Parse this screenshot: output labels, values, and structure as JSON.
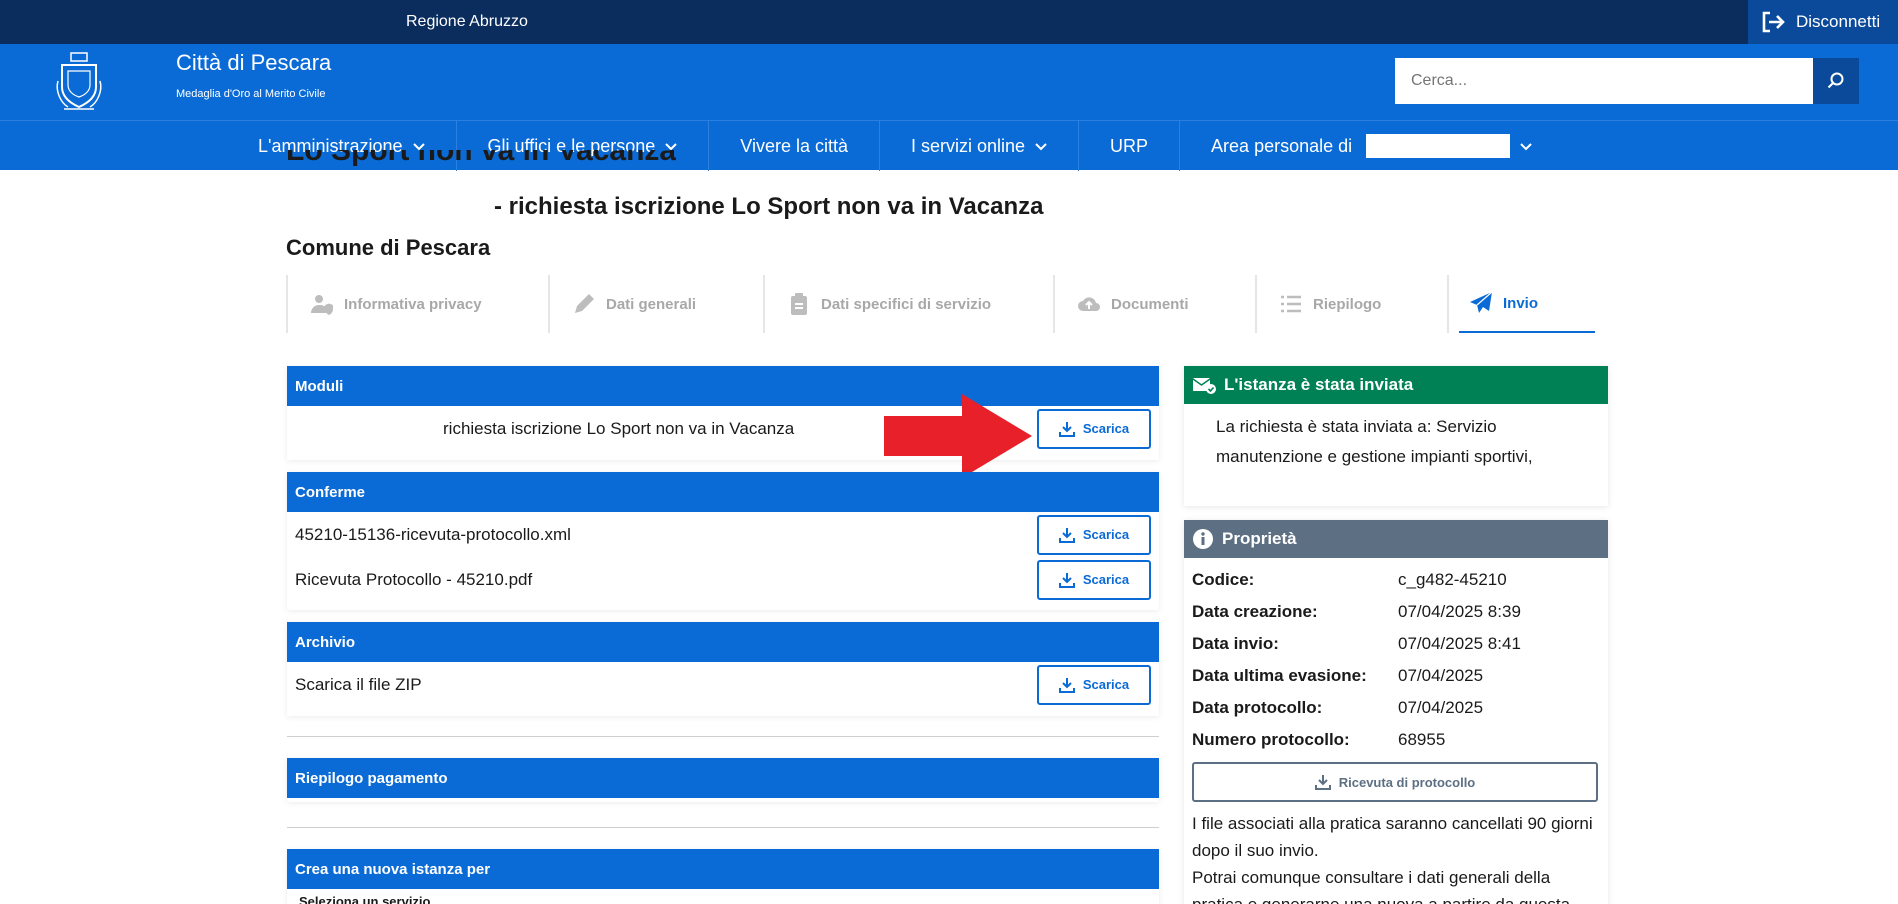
{
  "topbar": {
    "region": "Regione Abruzzo",
    "logout": "Disconnetti"
  },
  "header": {
    "title": "Città di Pescara",
    "subtitle": "Medaglia d'Oro al Merito Civile",
    "search_placeholder": "Cerca..."
  },
  "nav": {
    "items": [
      {
        "label": "L'amministrazione",
        "dropdown": true
      },
      {
        "label": "Gli uffici e le persone",
        "dropdown": true
      },
      {
        "label": "Vivere la città",
        "dropdown": false
      },
      {
        "label": "I servizi online",
        "dropdown": true
      },
      {
        "label": "URP",
        "dropdown": false
      },
      {
        "label": "Area personale di",
        "dropdown": true
      }
    ]
  },
  "page": {
    "partial_title": "Lo Sport non va in Vacanza",
    "title": "- richiesta iscrizione Lo Sport non va in Vacanza",
    "organization": "Comune di Pescara"
  },
  "steps": [
    {
      "label": "Informativa privacy",
      "icon": "user-shield-icon"
    },
    {
      "label": "Dati generali",
      "icon": "pencil-icon"
    },
    {
      "label": "Dati specifici di servizio",
      "icon": "clipboard-icon"
    },
    {
      "label": "Documenti",
      "icon": "cloud-upload-icon"
    },
    {
      "label": "Riepilogo",
      "icon": "list-icon"
    },
    {
      "label": "Invio",
      "icon": "paper-plane-icon"
    }
  ],
  "moduli": {
    "header": "Moduli",
    "rows": [
      {
        "label": "richiesta iscrizione Lo Sport non va in Vacanza",
        "button": "Scarica"
      }
    ]
  },
  "conferme": {
    "header": "Conferme",
    "rows": [
      {
        "label": "45210-15136-ricevuta-protocollo.xml",
        "button": "Scarica"
      },
      {
        "label": "Ricevuta Protocollo - 45210.pdf",
        "button": "Scarica"
      }
    ]
  },
  "archivio": {
    "header": "Archivio",
    "rows": [
      {
        "label": "Scarica il file ZIP",
        "button": "Scarica"
      }
    ]
  },
  "pagamento": {
    "header": "Riepilogo pagamento"
  },
  "nuova": {
    "header": "Crea una nuova istanza per",
    "select_label": "Seleziona un servizio"
  },
  "inviata": {
    "header": "L'istanza è stata inviata",
    "text": "La richiesta è stata inviata a: Servizio manutenzione e gestione impianti sportivi,"
  },
  "proprieta": {
    "header": "Proprietà",
    "items": [
      {
        "key": "Codice:",
        "value": "c_g482-45210"
      },
      {
        "key": "Data creazione:",
        "value": "07/04/2025 8:39"
      },
      {
        "key": "Data invio:",
        "value": "07/04/2025 8:41"
      },
      {
        "key": "Data ultima evasione:",
        "value": "07/04/2025"
      },
      {
        "key": "Data protocollo:",
        "value": "07/04/2025"
      },
      {
        "key": "Numero protocollo:",
        "value": "68955"
      }
    ],
    "button": "Ricevuta di protocollo",
    "note1": "I file associati alla pratica saranno cancellati 90 giorni dopo il suo invio.",
    "note2": "Potrai comunque consultare i dati generali della pratica e generarne una nuova a partire da questa."
  },
  "colors": {
    "primary": "#0b6bd6",
    "dark_navy": "#0a2d5e",
    "success": "#008055",
    "gray_header": "#5d7083",
    "arrow": "#e8202a"
  }
}
